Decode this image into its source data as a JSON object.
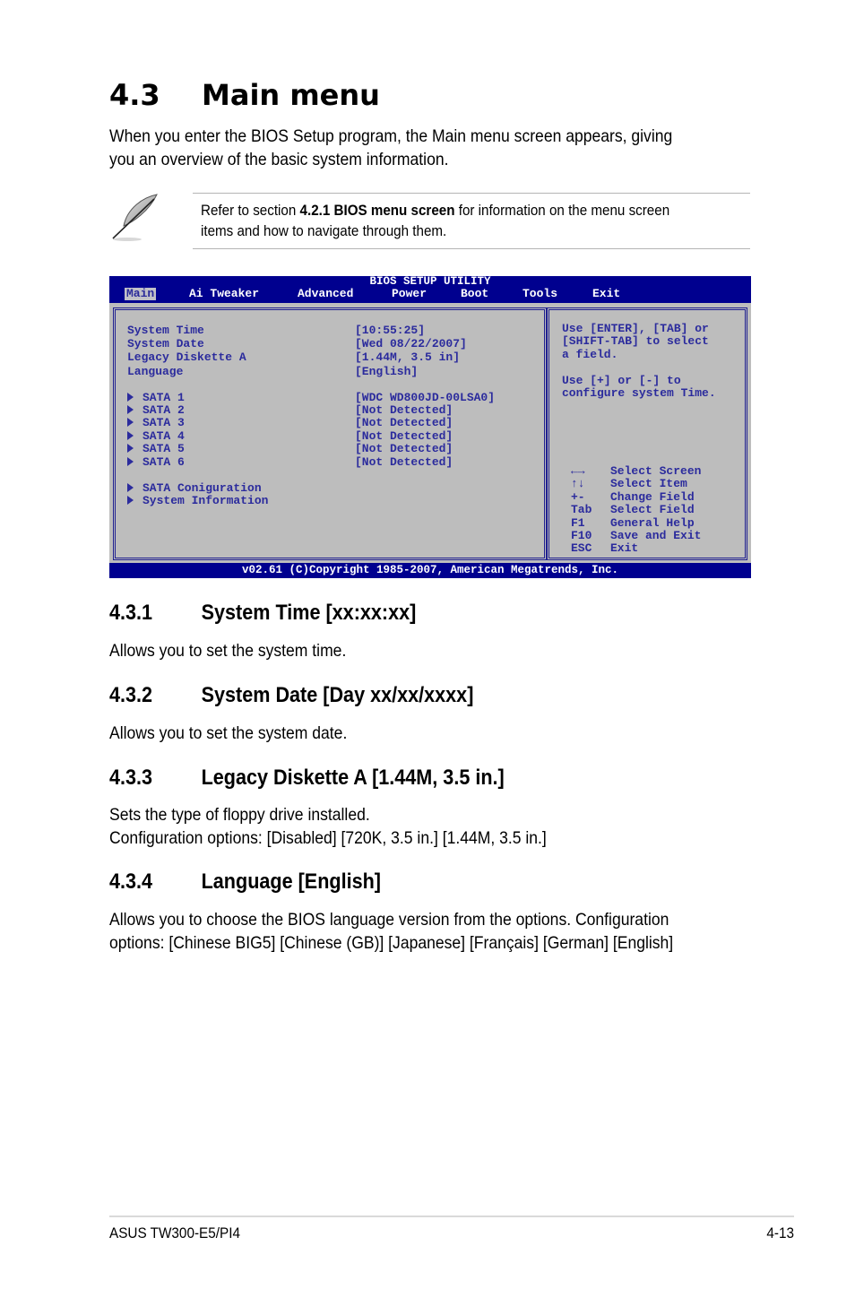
{
  "section": {
    "number": "4.3",
    "title": "Main menu",
    "intro_line1": "When you enter the BIOS Setup program, the Main menu screen appears, giving",
    "intro_line2": "you an overview of the basic system information."
  },
  "note": {
    "icon": "feather-pen-icon",
    "prefix": "Refer to section ",
    "ref_bold": "4.2.1  BIOS menu screen",
    "suffix": " for information on the menu screen",
    "line2": "items and how to navigate through them."
  },
  "bios": {
    "title": "BIOS SETUP UTILITY",
    "tabs": [
      {
        "label": "Main",
        "active": true
      },
      {
        "label": "Ai Tweaker",
        "active": false
      },
      {
        "label": "Advanced",
        "active": false
      },
      {
        "label": "Power",
        "active": false
      },
      {
        "label": "Boot",
        "active": false
      },
      {
        "label": "Tools",
        "active": false
      },
      {
        "label": "Exit",
        "active": false
      }
    ],
    "items": [
      {
        "label": "System Time",
        "value": "[10:55:25]"
      },
      {
        "label": "System Date",
        "value": "[Wed 08/22/2007]"
      },
      {
        "label": "Legacy Diskette A",
        "value": "[1.44M, 3.5 in]"
      },
      {
        "label": "Language",
        "value": "[English]"
      }
    ],
    "sata": [
      {
        "label": "SATA 1",
        "value": "[WDC WD800JD-00LSA0]"
      },
      {
        "label": "SATA 2",
        "value": "[Not Detected]"
      },
      {
        "label": "SATA 3",
        "value": "[Not Detected]"
      },
      {
        "label": "SATA 4",
        "value": "[Not Detected]"
      },
      {
        "label": "SATA 5",
        "value": "[Not Detected]"
      },
      {
        "label": "SATA 6",
        "value": "[Not Detected]"
      }
    ],
    "submenus": [
      {
        "label": "SATA Coniguration"
      },
      {
        "label": "System Information"
      }
    ],
    "help": {
      "line1": "Use [ENTER], [TAB] or",
      "line2": "[SHIFT-TAB] to select",
      "line3": "a field.",
      "line4": "Use [+] or [-] to",
      "line5": "configure system Time."
    },
    "keys": [
      {
        "key": "←→",
        "action": "Select Screen"
      },
      {
        "key": "↑↓",
        "action": "Select Item"
      },
      {
        "key": "+-",
        "action": "Change Field"
      },
      {
        "key": "Tab",
        "action": "Select Field"
      },
      {
        "key": "F1",
        "action": "General Help"
      },
      {
        "key": "F10",
        "action": "Save and Exit"
      },
      {
        "key": "ESC",
        "action": "Exit"
      }
    ],
    "footer": "v02.61 (C)Copyright 1985-2007, American Megatrends, Inc.",
    "colors": {
      "frame": "#00008f",
      "body": "#bdbdbd",
      "text": "#2b2b9d"
    }
  },
  "subsections": [
    {
      "number": "4.3.1",
      "title": "System Time [xx:xx:xx]",
      "lines": [
        "Allows you to set the system time."
      ]
    },
    {
      "number": "4.3.2",
      "title": "System Date [Day xx/xx/xxxx]",
      "lines": [
        "Allows you to set the system date."
      ]
    },
    {
      "number": "4.3.3",
      "title": "Legacy Diskette A [1.44M, 3.5 in.]",
      "lines": [
        "Sets the type of floppy drive installed.",
        "Configuration options: [Disabled] [720K, 3.5 in.] [1.44M, 3.5 in.]"
      ]
    },
    {
      "number": "4.3.4",
      "title": "Language [English]",
      "lines": [
        "Allows you to choose the BIOS language version from the options. Configuration",
        "options: [Chinese BIG5] [Chinese (GB)] [Japanese] [Français] [German] [English]"
      ]
    }
  ],
  "footer": {
    "product": "ASUS TW300-E5/PI4",
    "page": "4-13"
  }
}
